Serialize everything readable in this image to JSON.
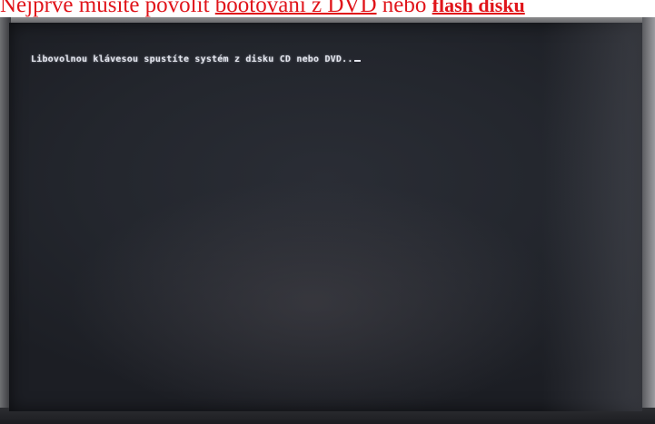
{
  "caption": {
    "prefix": "Nejprve musíte povolit ",
    "link1": "bootování z DVD",
    "middle": " nebo ",
    "link2": "flash disku"
  },
  "screen": {
    "boot_message": "Libovolnou klávesou spustíte systém z disku CD nebo DVD.."
  },
  "colors": {
    "caption": "#e0141a",
    "screen_text": "#e4e6ee",
    "screen_bg": "#23262d"
  }
}
